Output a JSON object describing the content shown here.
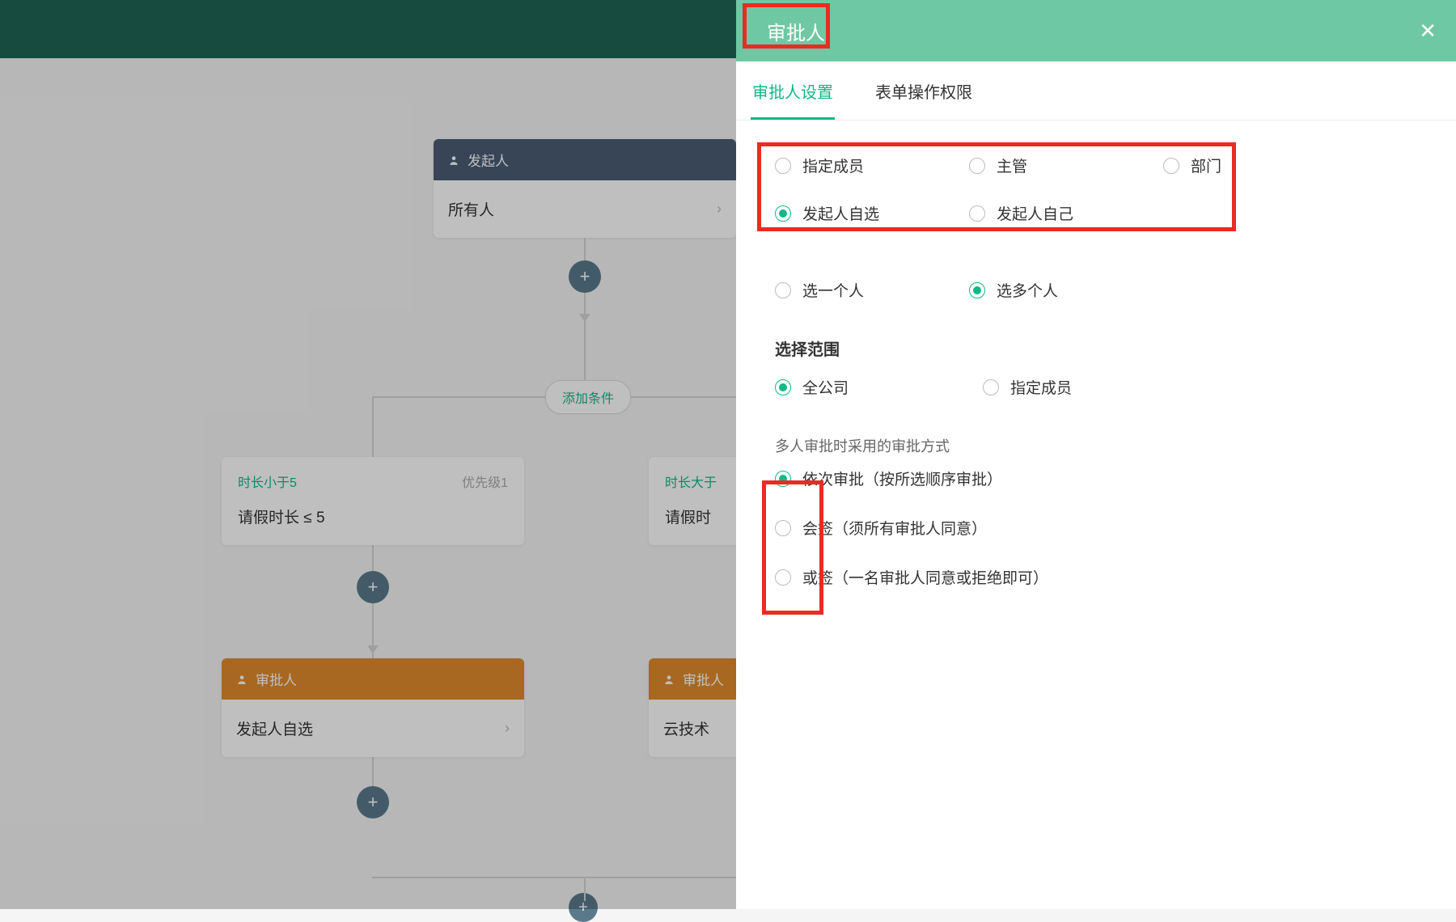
{
  "panel": {
    "title": "审批人",
    "tabs": {
      "settings": "审批人设置",
      "permissions": "表单操作权限"
    },
    "approver_type": {
      "specific": "指定成员",
      "supervisor": "主管",
      "department": "部门",
      "initiator_pick": "发起人自选",
      "initiator_self": "发起人自己"
    },
    "select_mode": {
      "one": "选一个人",
      "many": "选多个人"
    },
    "scope": {
      "heading": "选择范围",
      "all": "全公司",
      "specific": "指定成员"
    },
    "multi_mode": {
      "heading": "多人审批时采用的审批方式",
      "sequential": "依次审批（按所选顺序审批）",
      "countersign": "会签（须所有审批人同意）",
      "orsign": "或签（一名审批人同意或拒绝即可）"
    }
  },
  "flow": {
    "initiator": {
      "header": "发起人",
      "body": "所有人"
    },
    "add_condition": "添加条件",
    "cond_left": {
      "title": "时长小于5",
      "priority": "优先级1",
      "body": "请假时长 ≤ 5"
    },
    "cond_right": {
      "title": "时长大于",
      "body": "请假时"
    },
    "approver_left": {
      "header": "审批人",
      "body": "发起人自选"
    },
    "approver_right": {
      "header": "审批人",
      "body": "云技术"
    }
  }
}
